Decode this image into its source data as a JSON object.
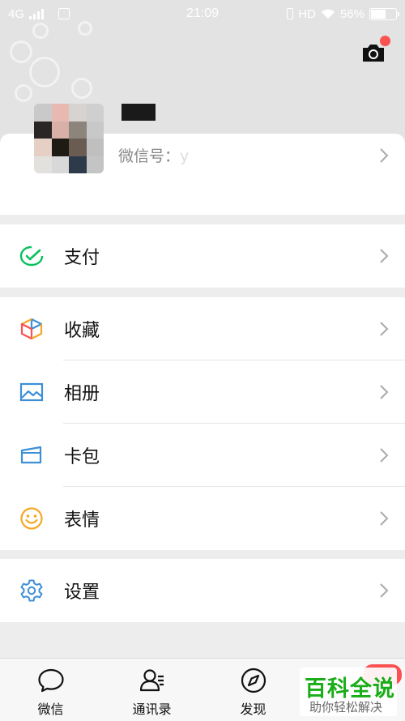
{
  "status_bar": {
    "network": "4G",
    "time": "21:09",
    "hd": "HD",
    "battery": "56%",
    "battery_level": 0.56
  },
  "profile": {
    "nickname": "███",
    "wechat_id_label": "微信号：",
    "wechat_id_value": "y"
  },
  "menu": {
    "pay": "支付",
    "favorites": "收藏",
    "album": "相册",
    "cards": "卡包",
    "stickers": "表情",
    "settings": "设置"
  },
  "tabs": {
    "chats": "微信",
    "contacts": "通讯录",
    "discover": "发现"
  },
  "watermark": {
    "title": "百科全说",
    "subtitle": "助你轻松解决"
  },
  "colors": {
    "accent_green": "#07c160",
    "badge_red": "#fa5151",
    "icon_blue": "#3d8fd6",
    "icon_orange": "#f6a623"
  },
  "icons": [
    "camera-icon",
    "pay-icon",
    "favorites-icon",
    "album-icon",
    "cards-icon",
    "stickers-icon",
    "settings-icon",
    "chevron-right-icon",
    "chat-icon",
    "contacts-icon",
    "discover-icon"
  ]
}
